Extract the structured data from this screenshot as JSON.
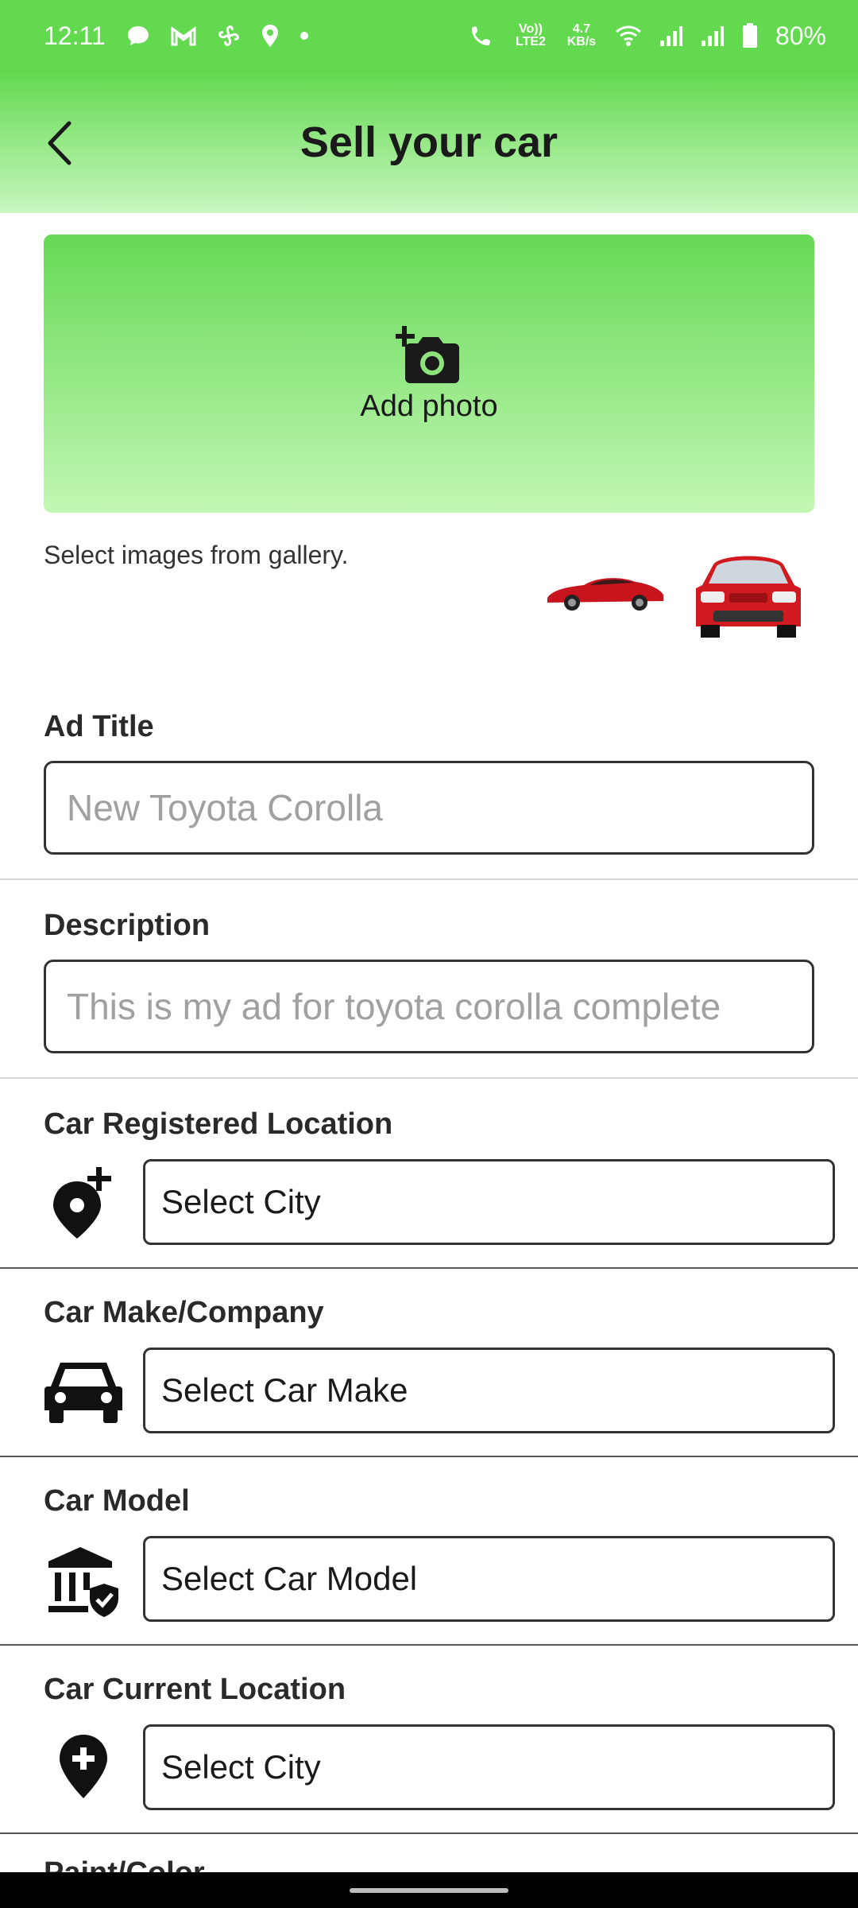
{
  "status_bar": {
    "time": "12:11",
    "volte_label": "Vo)) LTE2",
    "net_speed": "4.7 KB/s",
    "battery": "80%"
  },
  "app_bar": {
    "title": "Sell your car"
  },
  "photo": {
    "add_label": "Add photo",
    "gallery_hint": "Select images from gallery."
  },
  "form": {
    "ad_title": {
      "label": "Ad Title",
      "placeholder": "New Toyota Corolla"
    },
    "description": {
      "label": "Description",
      "placeholder": "This is my ad for toyota corolla complete"
    },
    "registered_location": {
      "label": "Car Registered Location",
      "value": "Select City",
      "icon": "location-add-icon"
    },
    "make": {
      "label": "Car Make/Company",
      "value": "Select Car Make",
      "icon": "car-icon"
    },
    "model": {
      "label": "Car Model",
      "value": "Select Car Model",
      "icon": "institution-verified-icon"
    },
    "current_location": {
      "label": "Car Current Location",
      "value": "Select City",
      "icon": "location-plus-icon"
    },
    "next_partial_label": "Paint/Color"
  },
  "colors": {
    "brand_green": "#63d94f",
    "gradient_light": "#c7f7bf"
  }
}
